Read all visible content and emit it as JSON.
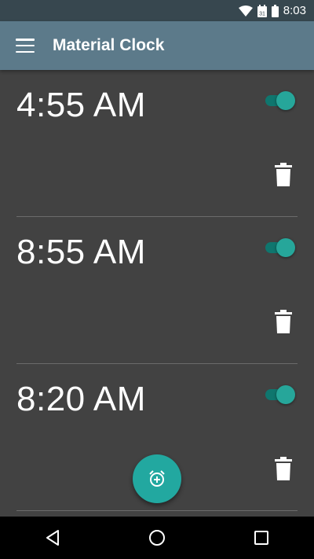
{
  "status_bar": {
    "time": "8:03",
    "icons": [
      "wifi-icon",
      "calendar-icon",
      "battery-icon"
    ],
    "calendar_day": "31"
  },
  "app_bar": {
    "title": "Material Clock",
    "menu_icon": "menu-icon"
  },
  "alarms": [
    {
      "time": "4:55 AM",
      "enabled": true
    },
    {
      "time": "8:55 AM",
      "enabled": true
    },
    {
      "time": "8:20 AM",
      "enabled": true
    }
  ],
  "fab": {
    "icon": "add-alarm-icon"
  },
  "nav_bar": {
    "icons": [
      "back-icon",
      "home-icon",
      "recents-icon"
    ]
  },
  "colors": {
    "background": "#424242",
    "app_bar": "#5c7a8a",
    "status_bar": "#37474f",
    "accent": "#26a69a"
  }
}
